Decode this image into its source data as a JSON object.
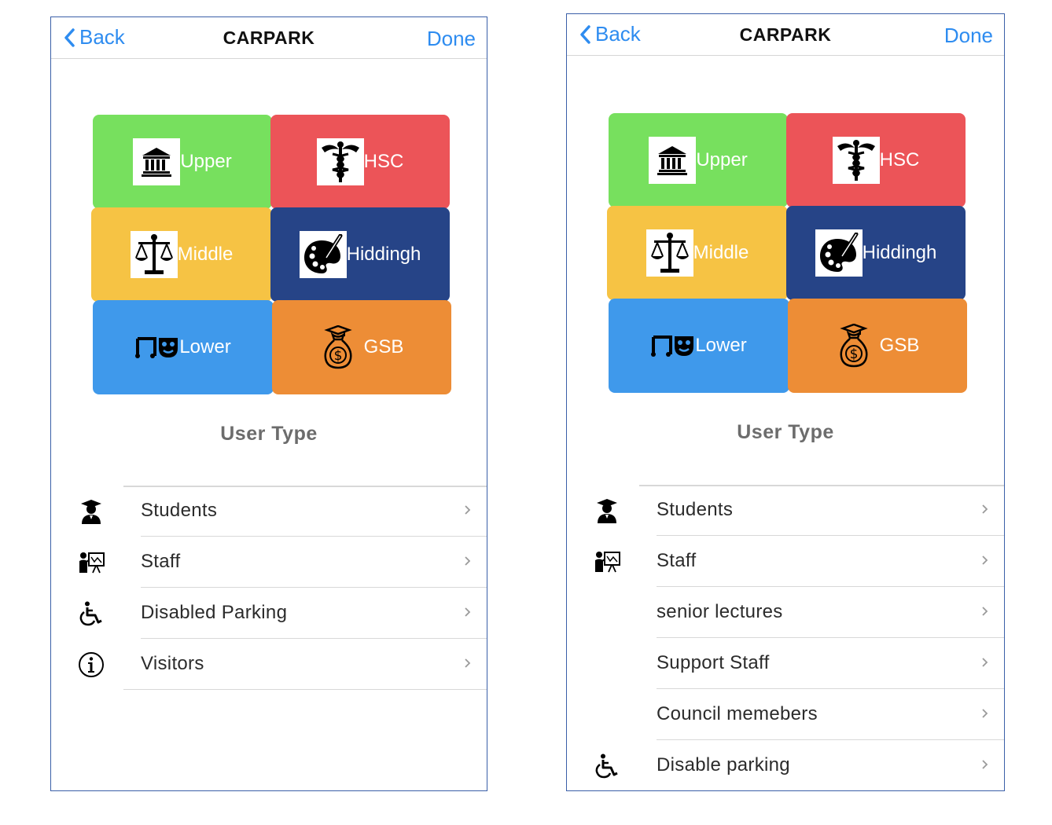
{
  "screens": [
    {
      "nav": {
        "back": "Back",
        "title": "CARPARK",
        "done": "Done"
      },
      "tiles": [
        {
          "label": "Upper",
          "icon": "bank-icon",
          "color": "#77e05e"
        },
        {
          "label": "HSC",
          "icon": "caduceus-icon",
          "color": "#ec5458"
        },
        {
          "label": "Middle",
          "icon": "scales-icon",
          "color": "#f6c344"
        },
        {
          "label": "Hiddingh",
          "icon": "palette-icon",
          "color": "#264487"
        },
        {
          "label": "Lower",
          "icon": "theatre-masks-icon",
          "color": "#3f99eb"
        },
        {
          "label": "GSB",
          "icon": "money-bag-icon",
          "color": "#ed8d36"
        }
      ],
      "section_title": "User Type",
      "items": [
        {
          "label": "Students",
          "icon": "student-icon"
        },
        {
          "label": "Staff",
          "icon": "teacher-icon"
        },
        {
          "label": "Disabled Parking",
          "icon": "wheelchair-icon"
        },
        {
          "label": "Visitors",
          "icon": "info-icon"
        }
      ]
    },
    {
      "nav": {
        "back": "Back",
        "title": "CARPARK",
        "done": "Done"
      },
      "tiles": [
        {
          "label": "Upper",
          "icon": "bank-icon",
          "color": "#77e05e"
        },
        {
          "label": "HSC",
          "icon": "caduceus-icon",
          "color": "#ec5458"
        },
        {
          "label": "Middle",
          "icon": "scales-icon",
          "color": "#f6c344"
        },
        {
          "label": "Hiddingh",
          "icon": "palette-icon",
          "color": "#264487"
        },
        {
          "label": "Lower",
          "icon": "theatre-masks-icon",
          "color": "#3f99eb"
        },
        {
          "label": "GSB",
          "icon": "money-bag-icon",
          "color": "#ed8d36"
        }
      ],
      "section_title": "User Type",
      "items": [
        {
          "label": "Students",
          "icon": "student-icon"
        },
        {
          "label": "Staff",
          "icon": "teacher-icon"
        },
        {
          "label": "senior lectures",
          "icon": ""
        },
        {
          "label": "Support Staff",
          "icon": ""
        },
        {
          "label": "Council memebers",
          "icon": ""
        },
        {
          "label": "Disable parking",
          "icon": "wheelchair-icon"
        }
      ]
    }
  ],
  "colors": {
    "accent": "#2e8cf0",
    "frame": "#3a5fa8"
  }
}
